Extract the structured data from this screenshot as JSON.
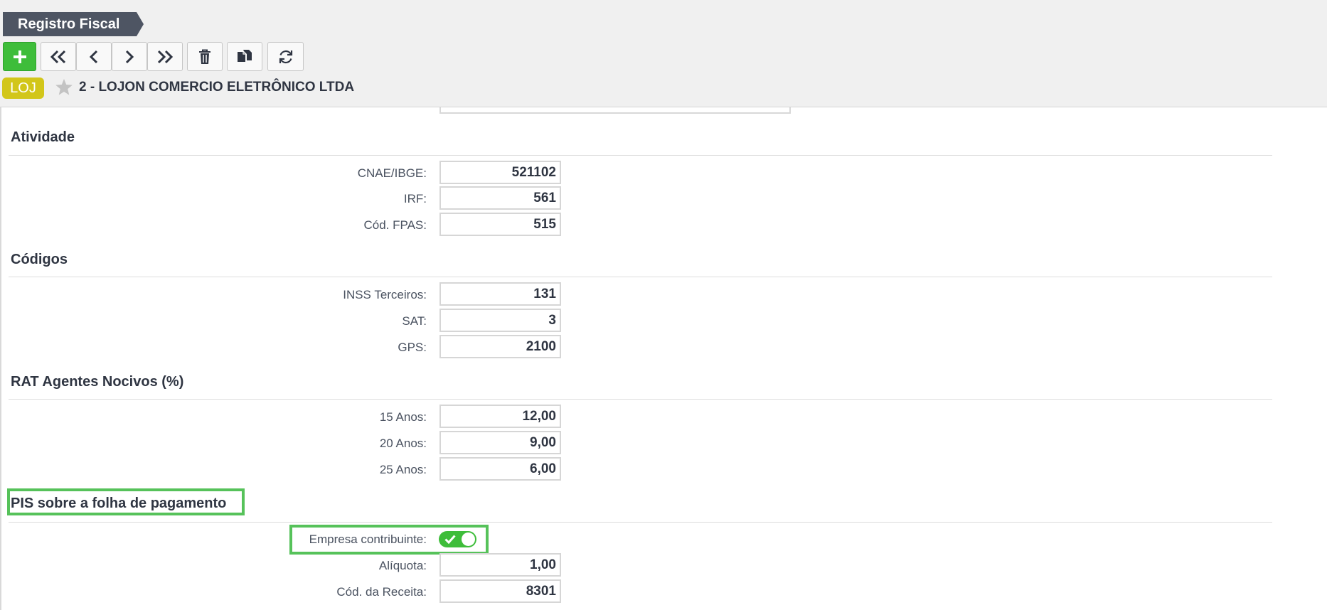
{
  "header": {
    "title": "Registro Fiscal",
    "badge": "LOJ",
    "company": "2 - LOJON COMERCIO ELETRÔNICO LTDA"
  },
  "toolbar": {
    "buttons": [
      {
        "name": "add",
        "icon": "plus-icon"
      },
      {
        "name": "first",
        "icon": "double-chevron-left-icon"
      },
      {
        "name": "previous",
        "icon": "chevron-left-icon"
      },
      {
        "name": "next",
        "icon": "chevron-right-icon"
      },
      {
        "name": "last",
        "icon": "double-chevron-right-icon"
      },
      {
        "name": "delete",
        "icon": "trash-icon"
      },
      {
        "name": "copy",
        "icon": "copy-icon"
      },
      {
        "name": "refresh",
        "icon": "refresh-icon"
      }
    ]
  },
  "colors": {
    "header_bg": "#f0f0f0",
    "tab_bg": "#4e5563",
    "add_green": "#3ebd3a",
    "badge_yellow": "#d2c61a",
    "highlight_green": "#56c25a"
  },
  "sections": {
    "atividade": {
      "title": "Atividade",
      "fields": [
        {
          "label": "CNAE/IBGE:",
          "value": "521102"
        },
        {
          "label": "IRF:",
          "value": "561"
        },
        {
          "label": "Cód. FPAS:",
          "value": "515"
        }
      ]
    },
    "codigos": {
      "title": "Códigos",
      "fields": [
        {
          "label": "INSS Terceiros:",
          "value": "131"
        },
        {
          "label": "SAT:",
          "value": "3"
        },
        {
          "label": "GPS:",
          "value": "2100"
        }
      ]
    },
    "rat": {
      "title": "RAT Agentes Nocivos (%)",
      "fields": [
        {
          "label": "15 Anos:",
          "value": "12,00"
        },
        {
          "label": "20 Anos:",
          "value": "9,00"
        },
        {
          "label": "25 Anos:",
          "value": "6,00"
        }
      ]
    },
    "pis": {
      "title": "PIS sobre a folha de pagamento",
      "toggle": {
        "label": "Empresa contribuinte:",
        "checked": true
      },
      "fields": [
        {
          "label": "Alíquota:",
          "value": "1,00"
        },
        {
          "label": "Cód. da Receita:",
          "value": "8301"
        }
      ]
    }
  }
}
